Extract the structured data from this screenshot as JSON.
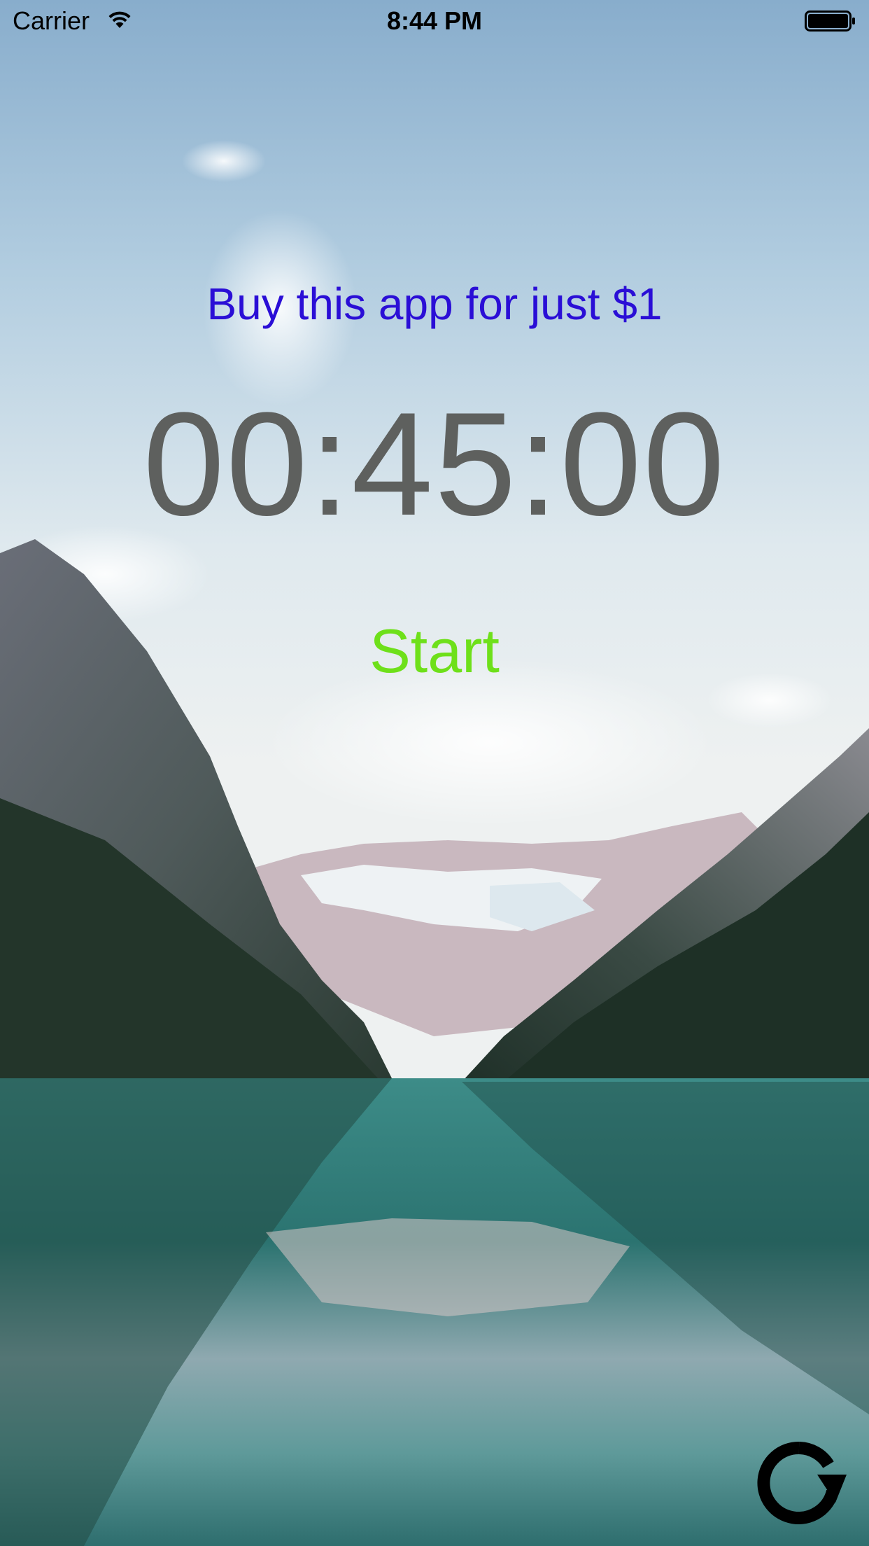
{
  "status_bar": {
    "carrier": "Carrier",
    "time": "8:44 PM",
    "icons": [
      "wifi-icon",
      "battery-icon"
    ]
  },
  "promo": {
    "label": "Buy this app for just $1",
    "color": "#2a0ed6"
  },
  "timer": {
    "value": "00:45:00",
    "color": "#5e605e"
  },
  "controls": {
    "start_label": "Start",
    "start_color": "#6ee01a",
    "reset_icon": "refresh-icon"
  }
}
